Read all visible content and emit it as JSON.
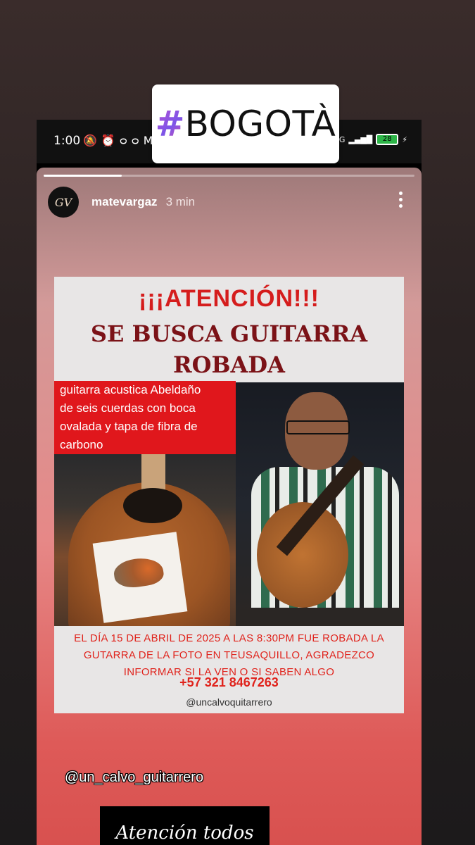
{
  "statusbar": {
    "time": "1:00",
    "network": "4G",
    "battery": "28"
  },
  "story": {
    "progress_fraction": 0.21,
    "username": "matevargaz",
    "time_ago": "3 min",
    "avatar_text": "GV"
  },
  "poster": {
    "title": "¡¡¡ATENCIÓN!!!",
    "subtitle_line1": "SE BUSCA GUITARRA",
    "subtitle_line2": "ROBADA",
    "description": [
      "guitarra acustica Abeldaño",
      "de seis cuerdas con boca",
      "ovalada y tapa de fibra de",
      "carbono"
    ],
    "details": [
      "EL DÍA 15 DE ABRIL DE 2025 A LAS 8:30PM FUE ROBADA LA",
      "GUTARRA DE LA FOTO EN TEUSAQUILLO, AGRADEZCO",
      "INFORMAR SI LA VEN O SI SABEN ALGO"
    ],
    "phone": "+57 321 8467263",
    "handle": "@uncalvoquitarrero"
  },
  "mention": "@un_calvo_guitarrero",
  "caption": "Atención todos",
  "hashtag": {
    "symbol": "#",
    "text": "BOGOTÀ"
  }
}
